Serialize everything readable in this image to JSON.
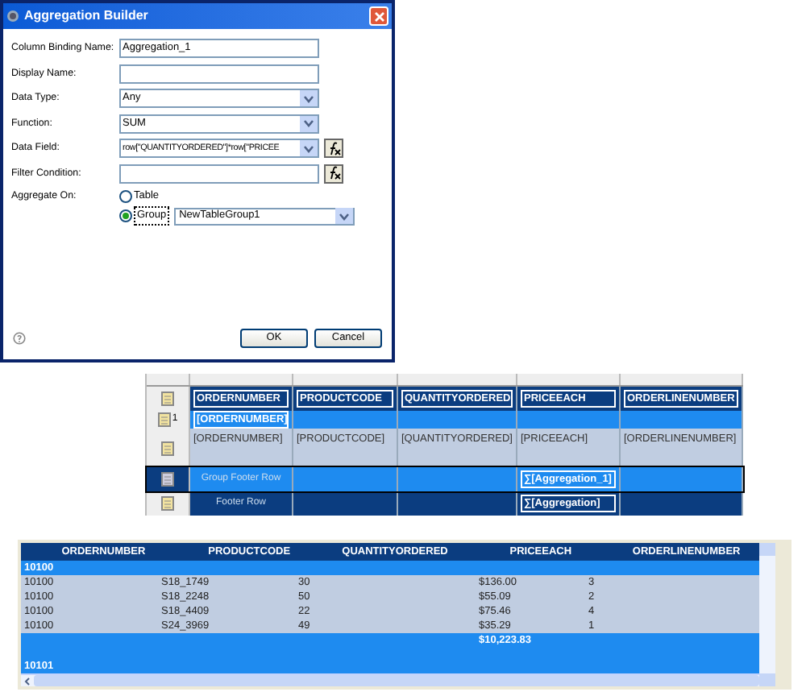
{
  "dialog": {
    "title": "Aggregation Builder",
    "fields": [
      {
        "kind": "text",
        "label": "Column Binding Name:",
        "value": "Aggregation_1"
      },
      {
        "kind": "text",
        "label": "Display Name:"
      },
      {
        "kind": "select",
        "label": "Data Type:",
        "value": "Any"
      },
      {
        "kind": "select",
        "label": "Function:",
        "value": "SUM"
      },
      {
        "kind": "select_fx",
        "label": "Data Field:",
        "value": "row[\"QUANTITYORDERED\"]*row[\"PRICEE"
      },
      {
        "kind": "text_fx",
        "label": "Filter Condition:"
      }
    ],
    "aggregate_on": {
      "label": "Aggregate On:",
      "options": [
        {
          "label": "Table",
          "selected": false
        },
        {
          "label": "Group",
          "selected": true,
          "value": "NewTableGroup1"
        }
      ]
    },
    "buttons": [
      "OK",
      "Cancel"
    ]
  },
  "layout_table": {
    "rows": [
      {
        "kind": "header",
        "selected": false,
        "cells": [
          "ORDERNUMBER",
          "PRODUCTCODE",
          "QUANTITYORDERED",
          "PRICEEACH",
          "ORDERLINENUMBER"
        ]
      },
      {
        "kind": "group_header",
        "selected": false,
        "group_number": "1",
        "cells": [
          "[ORDERNUMBER]",
          "",
          "",
          "",
          ""
        ]
      },
      {
        "kind": "detail",
        "selected": false,
        "cells": [
          "[ORDERNUMBER]",
          "[PRODUCTCODE]",
          "[QUANTITYORDERED]",
          "[PRICEEACH]",
          "[ORDERLINENUMBER]"
        ]
      },
      {
        "kind": "group_footer",
        "selected": true,
        "cells": [
          "Group Footer Row",
          "",
          "",
          "∑[Aggregation_1]",
          ""
        ]
      },
      {
        "kind": "footer",
        "selected": false,
        "cells": [
          "Footer Row",
          "",
          "",
          "∑[Aggregation]",
          ""
        ]
      }
    ]
  },
  "preview": {
    "columns": [
      "ORDERNUMBER",
      "PRODUCTCODE",
      "QUANTITYORDERED",
      "PRICEEACH",
      "ORDERLINENUMBER"
    ],
    "rows": [
      {
        "kind": "group_header",
        "cells": [
          "10100",
          "",
          "",
          "",
          ""
        ]
      },
      {
        "kind": "detail",
        "cells": [
          "10100",
          "S18_1749",
          "30",
          "$136.00",
          "3"
        ]
      },
      {
        "kind": "detail",
        "cells": [
          "10100",
          "S18_2248",
          "50",
          "$55.09",
          "2"
        ]
      },
      {
        "kind": "detail",
        "cells": [
          "10100",
          "S18_4409",
          "22",
          "$75.46",
          "4"
        ]
      },
      {
        "kind": "detail",
        "cells": [
          "10100",
          "S24_3969",
          "49",
          "$35.29",
          "1"
        ]
      },
      {
        "kind": "group_footer",
        "cells": [
          "",
          "",
          "",
          "$10,223.83",
          ""
        ]
      },
      {
        "kind": "group_header",
        "cells": [
          "10101",
          "",
          "",
          "",
          ""
        ]
      }
    ]
  }
}
